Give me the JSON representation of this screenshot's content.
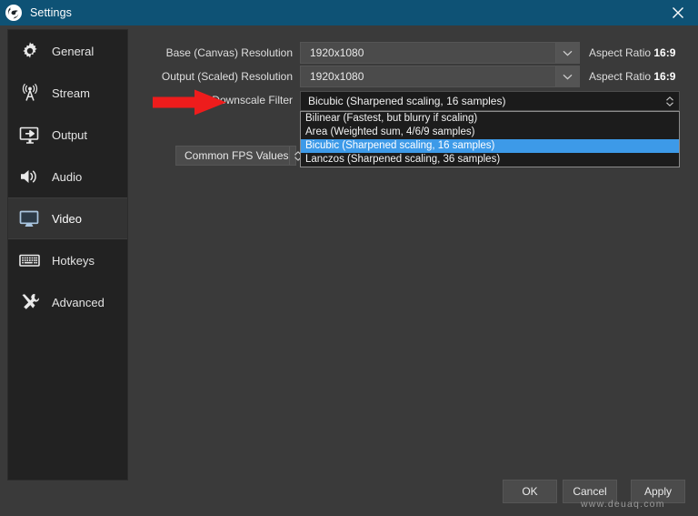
{
  "window": {
    "title": "Settings",
    "logo_icon": "obs-logo-icon",
    "close_icon": "close-icon",
    "titlebar_color": "#0e5275"
  },
  "sidebar": {
    "items": [
      {
        "label": "General",
        "icon": "gear-icon",
        "selected": false
      },
      {
        "label": "Stream",
        "icon": "broadcast-icon",
        "selected": false
      },
      {
        "label": "Output",
        "icon": "monitor-arrow-icon",
        "selected": false
      },
      {
        "label": "Audio",
        "icon": "speaker-icon",
        "selected": false
      },
      {
        "label": "Video",
        "icon": "monitor-icon",
        "selected": true
      },
      {
        "label": "Hotkeys",
        "icon": "keyboard-icon",
        "selected": false
      },
      {
        "label": "Advanced",
        "icon": "tools-icon",
        "selected": false
      }
    ]
  },
  "main": {
    "base_resolution": {
      "label": "Base (Canvas) Resolution",
      "value": "1920x1080",
      "dropdown_icon": "chevron-down-icon",
      "aspect_prefix": "Aspect Ratio ",
      "aspect_value": "16:9"
    },
    "output_resolution": {
      "label": "Output (Scaled) Resolution",
      "value": "1920x1080",
      "dropdown_icon": "chevron-down-icon",
      "aspect_prefix": "Aspect Ratio ",
      "aspect_value": "16:9"
    },
    "downscale_filter": {
      "label": "Downscale Filter",
      "value": "Bicubic (Sharpened scaling, 16 samples)",
      "expanded": true,
      "spinner_icon": "chevron-up-down-icon",
      "options": [
        {
          "label": "Bilinear (Fastest, but blurry if scaling)",
          "highlighted": false
        },
        {
          "label": "Area (Weighted sum, 4/6/9 samples)",
          "highlighted": false
        },
        {
          "label": "Bicubic (Sharpened scaling, 16 samples)",
          "highlighted": true
        },
        {
          "label": "Lanczos (Sharpened scaling, 36 samples)",
          "highlighted": false
        }
      ],
      "highlight_color": "#3d9ae8"
    },
    "common_fps": {
      "label": "Common FPS Values",
      "spinner_icon": "chevron-up-down-icon"
    },
    "annotation": {
      "type": "red-arrow",
      "color": "#ee1c1c",
      "points_at": "Downscale Filter"
    }
  },
  "footer": {
    "ok_label": "OK",
    "cancel_label": "Cancel",
    "apply_label": "Apply"
  },
  "watermark": {
    "text": "www.deuaq.com"
  }
}
